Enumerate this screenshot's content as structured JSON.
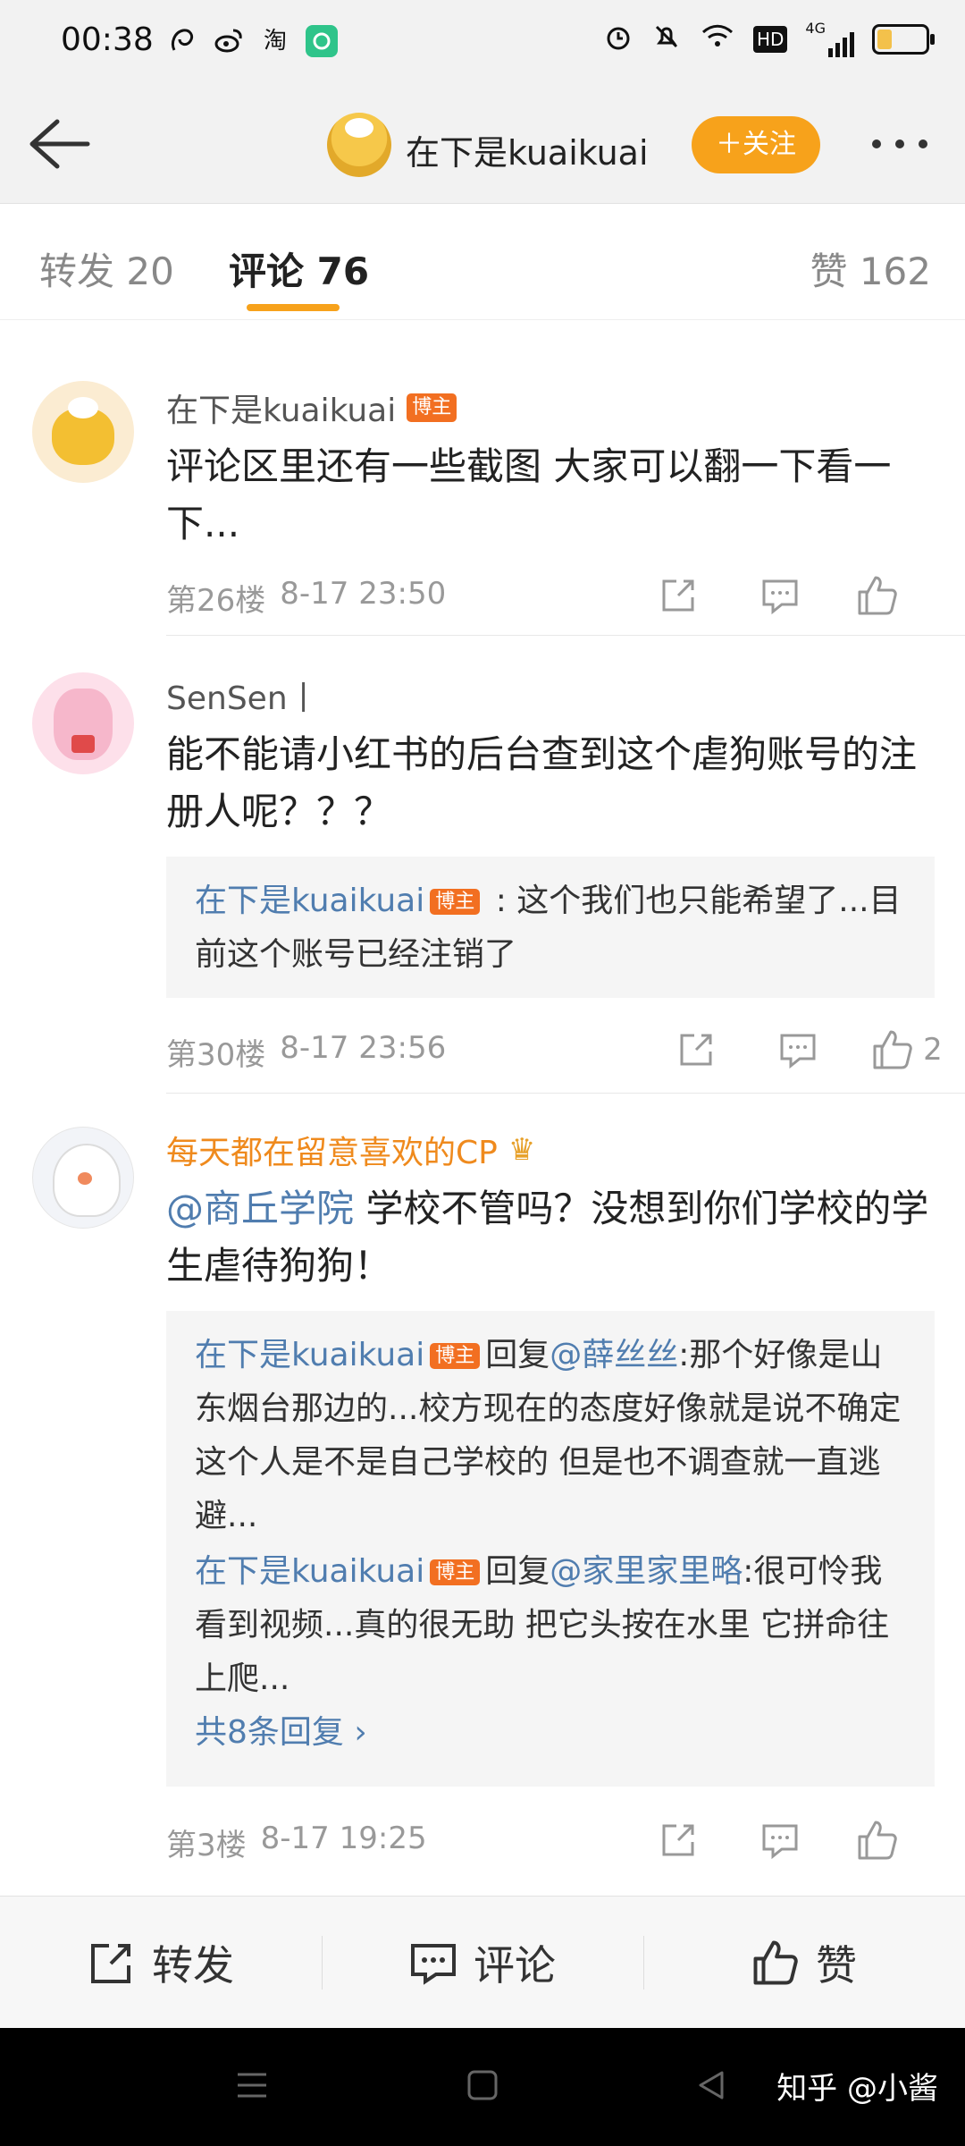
{
  "status_bar": {
    "time": "00:38",
    "app_icons": [
      "squirrel-icon",
      "weibo-icon",
      "淘",
      "app-icon"
    ],
    "right_icons": [
      "alarm-icon",
      "mute-icon",
      "wifi-icon",
      "HD",
      "4G",
      "battery-icon"
    ],
    "hd_label": "HD",
    "net_label": "4G",
    "battery_level": 0.3
  },
  "nav": {
    "title": "在下是kuaikuai",
    "follow_label": "＋关注"
  },
  "tabs": [
    {
      "label": "转发 20"
    },
    {
      "label": "评论 76"
    },
    {
      "label": "赞 162"
    }
  ],
  "comments": [
    {
      "name": "在下是kuaikuai",
      "badge": "博主",
      "text": "评论区里还有一些截图 大家可以翻一下看一下...",
      "floor": "第26楼",
      "time": "8-17 23:50",
      "likes": ""
    },
    {
      "name": "SenSen丨",
      "text": "能不能请小红书的后台查到这个虐狗账号的注册人呢？？？",
      "replies": [
        {
          "name": "在下是kuaikuai",
          "badge": "博主",
          "prefix": "",
          "mention": "",
          "text": " : 这个我们也只能希望了...目前这个账号已经注销了"
        }
      ],
      "floor": "第30楼",
      "time": "8-17 23:56",
      "likes": "2"
    },
    {
      "name": "每天都在留意喜欢的CP",
      "mention": "@商丘学院",
      "text": " 学校不管吗？没想到你们学校的学生虐待狗狗！",
      "replies": [
        {
          "name": "在下是kuaikuai",
          "badge": "博主",
          "prefix": "回复",
          "mention": "@薛丝丝",
          "text": ":那个好像是山东烟台那边的...校方现在的态度好像就是说不确定这个人是不是自己学校的 但是也不调查就一直逃避..."
        },
        {
          "name": "在下是kuaikuai",
          "badge": "博主",
          "prefix": "回复",
          "mention": "@家里家里略",
          "text": ":很可怜我看到视频...真的很无助 把它头按在水里 它拼命往上爬..."
        }
      ],
      "more_replies": "共8条回复 ›",
      "floor": "第3楼",
      "time": "8-17 19:25",
      "likes": ""
    }
  ],
  "bottom_bar": {
    "repost": "转发",
    "comment": "评论",
    "like": "赞"
  },
  "watermark": "知乎 @小酱",
  "colors": {
    "accent": "#f7a21b",
    "link": "#507daf",
    "vip_name": "#ef8a1d",
    "badge": "#f26f21"
  }
}
